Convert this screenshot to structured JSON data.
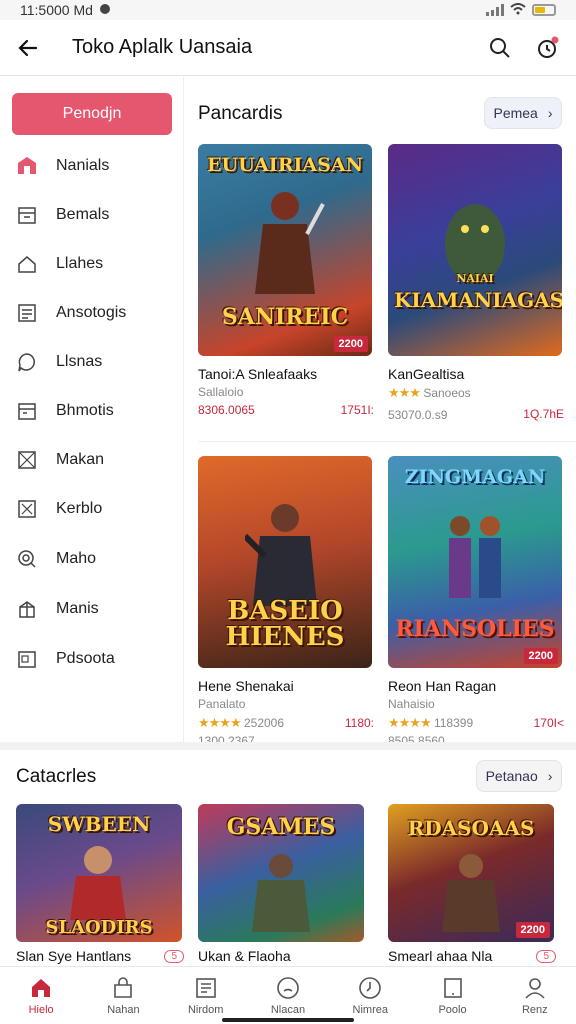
{
  "status_bar": {
    "time": "11:5000 Md"
  },
  "header": {
    "title": "Toko Aplalk Uansaia"
  },
  "sidebar": {
    "button_label": "Penodjn",
    "items": [
      {
        "label": "Nanials",
        "icon": "store-icon"
      },
      {
        "label": "Bemals",
        "icon": "calendar-icon"
      },
      {
        "label": "Llahes",
        "icon": "house-icon"
      },
      {
        "label": "Ansotogis",
        "icon": "document-icon"
      },
      {
        "label": "Llsnas",
        "icon": "chat-icon"
      },
      {
        "label": "Bhmotis",
        "icon": "calendar-icon"
      },
      {
        "label": "Makan",
        "icon": "grid-icon"
      },
      {
        "label": "Kerblo",
        "icon": "puzzle-icon"
      },
      {
        "label": "Maho",
        "icon": "search-icon"
      },
      {
        "label": "Manis",
        "icon": "gift-icon"
      },
      {
        "label": "Pdsoota",
        "icon": "document-icon"
      }
    ]
  },
  "main": {
    "section_title": "Pancardis",
    "see_all": "Pemea",
    "games": [
      {
        "cover_top": "EUUAIRIASAN",
        "cover_bottom": "SANIREIC",
        "price_tag": "2200",
        "name": "Tanoi:A Snleafaaks",
        "sub": "Sallaloio",
        "price": "8306.0065",
        "count": "1751I:",
        "colors": [
          "#2f6a8c",
          "#c7442a"
        ]
      },
      {
        "cover_top": "NAIAI",
        "cover_bottom": "KIAMANIAGAS",
        "price_tag": "",
        "name": "KanGealtisa",
        "sub": "Sanoeos",
        "price": "53070.0.s9",
        "count": "1Q.7hE",
        "colors": [
          "#5b2a86",
          "#e06a1f"
        ]
      },
      {
        "cover_top": "",
        "cover_bottom": "BASEIO HIENES",
        "price_tag": "",
        "name": "Hene Shenakai",
        "sub": "Panalato",
        "price": "1300.2367",
        "count": "1180:",
        "rating": "252006",
        "colors": [
          "#b4472a",
          "#3b2418"
        ]
      },
      {
        "cover_top": "ZINGMAGAN",
        "cover_bottom": "RIANSOLIES",
        "price_tag": "2200",
        "name": "Reon Han Ragan",
        "sub": "Nahaisio",
        "price": "8505.8560",
        "count": "170I<",
        "rating": "118399",
        "colors": [
          "#2b9a8e",
          "#3b5fa8"
        ]
      }
    ]
  },
  "categories": {
    "title": "Catacrles",
    "see_all": "Petanao",
    "items": [
      {
        "cover_top": "SWBEEN",
        "cover_bottom": "SLAODIRS",
        "name": "Slan Sye Hantlans",
        "badge": "5",
        "colors": [
          "#3a4a7a",
          "#d0542a"
        ]
      },
      {
        "cover_top": "GSAMES",
        "cover_bottom": "",
        "name": "Ukan & Flaoha",
        "badge": "",
        "colors": [
          "#3a5fa0",
          "#a25a2a"
        ]
      },
      {
        "cover_top": "RDASOAAS",
        "cover_bottom": "",
        "price_tag": "2200",
        "name": "Smearl ahaa Nla",
        "badge": "5",
        "colors": [
          "#7a2a2a",
          "#e0a020"
        ]
      }
    ]
  },
  "bottom_nav": [
    {
      "label": "Hielo",
      "icon": "home-icon"
    },
    {
      "label": "Nahan",
      "icon": "bag-icon"
    },
    {
      "label": "Nirdom",
      "icon": "list-icon"
    },
    {
      "label": "Nlacan",
      "icon": "face-icon"
    },
    {
      "label": "Nimrea",
      "icon": "clock-icon"
    },
    {
      "label": "Poolo",
      "icon": "tablet-icon"
    },
    {
      "label": "Renz",
      "icon": "person-icon"
    }
  ],
  "colors": {
    "accent": "#e5566f",
    "price": "#c8283c",
    "star": "#e8a321"
  }
}
